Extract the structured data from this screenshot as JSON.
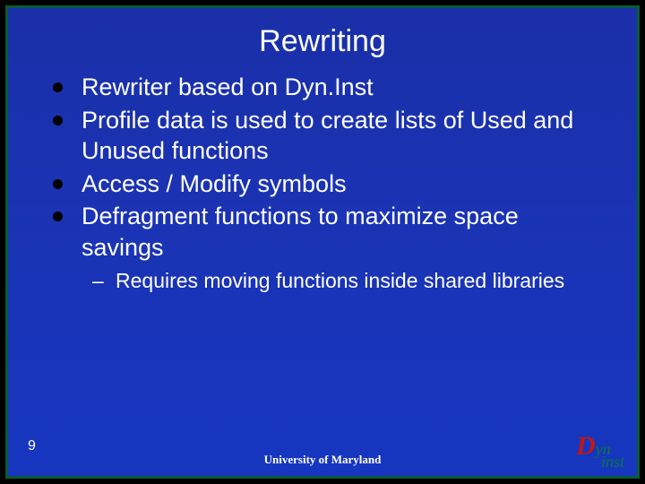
{
  "title": "Rewriting",
  "bullets": [
    "Rewriter based on Dyn.Inst",
    "Profile data is used to create lists of Used and Unused functions",
    "Access / Modify symbols",
    "Defragment functions to maximize space savings"
  ],
  "subbullets": [
    "Requires moving functions inside shared libraries"
  ],
  "pageNumber": "9",
  "footer": "University of Maryland",
  "logo": {
    "d": "D",
    "yn": "yn",
    "inst": "inst"
  }
}
